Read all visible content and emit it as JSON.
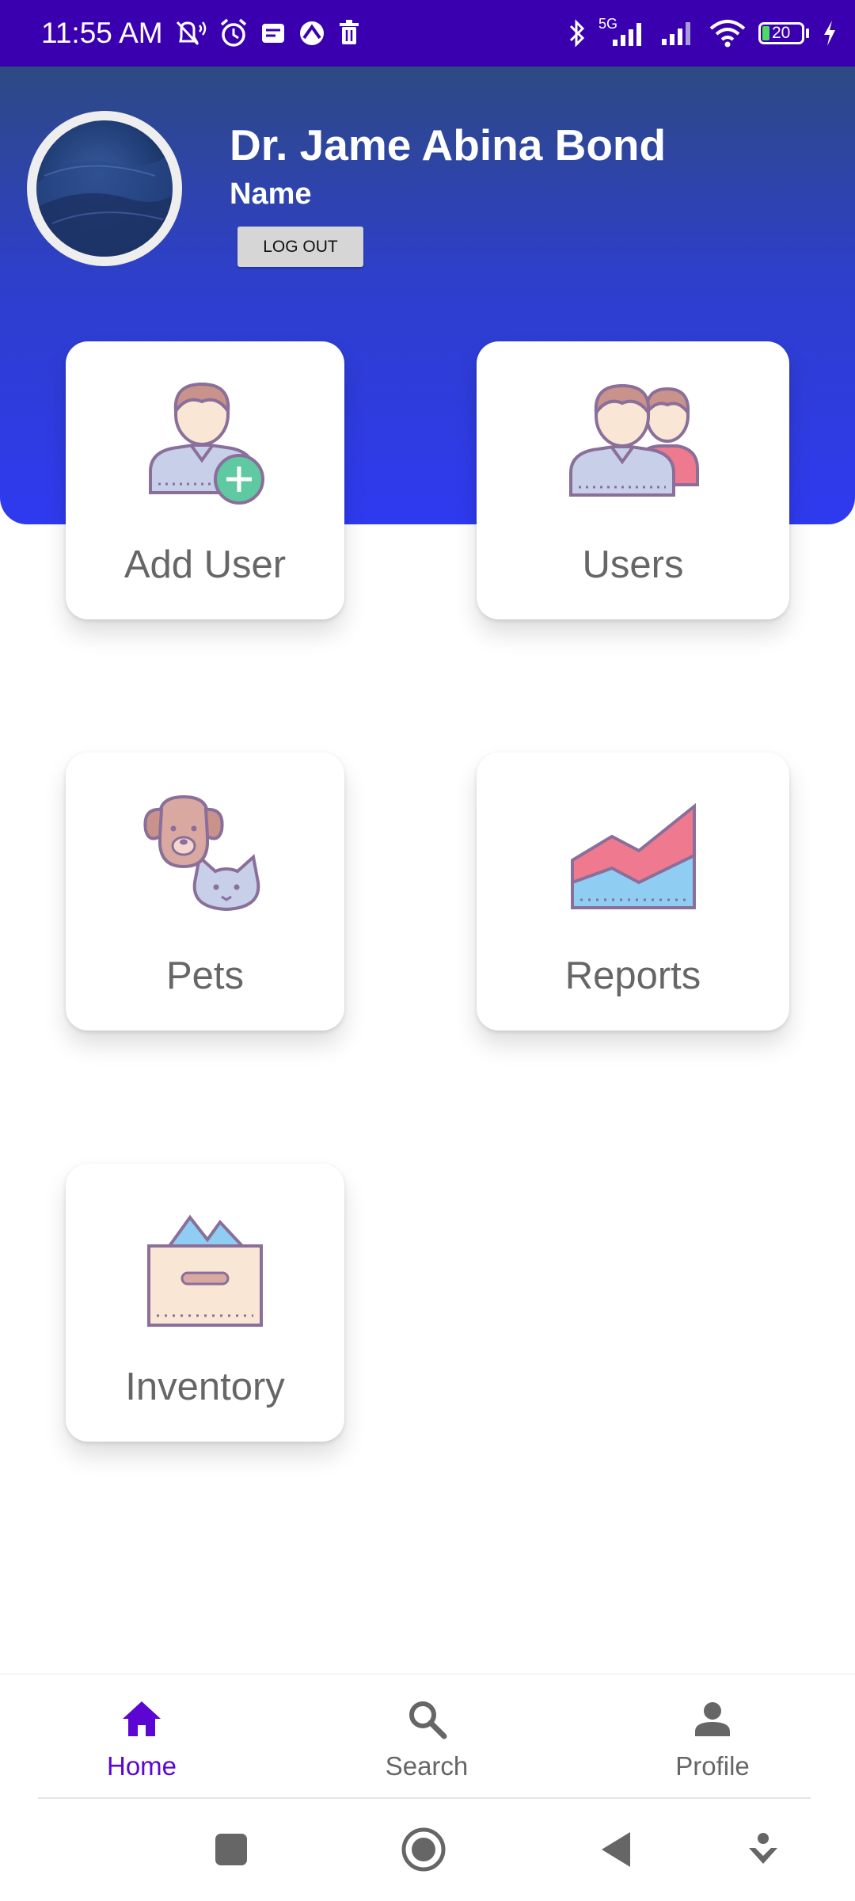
{
  "status_bar": {
    "time": "11:55 AM",
    "network": "5G",
    "battery": "20",
    "left_icons": [
      "muted-alert-icon",
      "alarm-icon",
      "message-icon",
      "vpn-icon",
      "trash-icon"
    ],
    "right_icons": [
      "bluetooth-icon",
      "signal-5g-icon",
      "signal-icon",
      "wifi-icon",
      "battery-icon",
      "charging-icon"
    ]
  },
  "header": {
    "user_name": "Dr. Jame Abina Bond",
    "subtitle": "Name",
    "logout_label": "LOG OUT"
  },
  "cards": [
    {
      "label": "Add User",
      "icon": "add-user-icon"
    },
    {
      "label": "Users",
      "icon": "users-icon"
    },
    {
      "label": "Pets",
      "icon": "pets-icon"
    },
    {
      "label": "Reports",
      "icon": "reports-icon"
    },
    {
      "label": "Inventory",
      "icon": "inventory-icon"
    }
  ],
  "bottom_nav": {
    "items": [
      {
        "label": "Home",
        "icon": "home-icon",
        "active": true
      },
      {
        "label": "Search",
        "icon": "search-icon",
        "active": false
      },
      {
        "label": "Profile",
        "icon": "profile-icon",
        "active": false
      }
    ]
  },
  "colors": {
    "status_bar": "#3a00b0",
    "header_top": "#2d4a82",
    "header_bottom": "#2f3af0",
    "active_nav": "#5b06d3",
    "inactive_nav": "#666666",
    "card_label": "#666666"
  }
}
